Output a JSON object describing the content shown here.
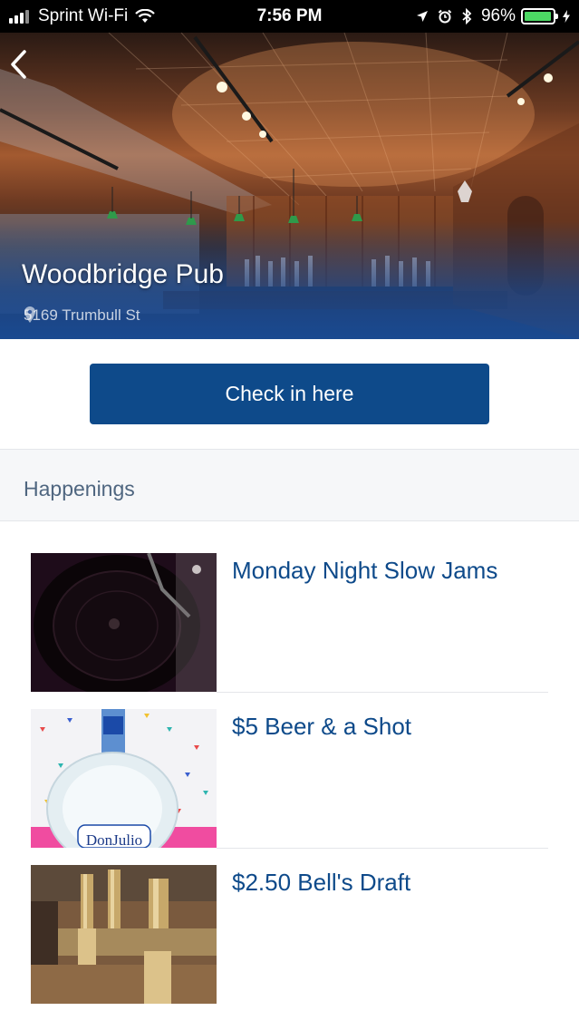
{
  "status_bar": {
    "carrier": "Sprint Wi-Fi",
    "time": "7:56 PM",
    "battery": "96%",
    "battery_level": 0.96
  },
  "venue": {
    "name": "Woodbridge Pub",
    "address": "5169 Trumbull St"
  },
  "checkin": {
    "label": "Check in here"
  },
  "happenings": {
    "title": "Happenings",
    "items": [
      {
        "title": "Monday Night Slow Jams",
        "image": "record-player"
      },
      {
        "title": "$5 Beer & a Shot",
        "image": "tequila-bottle"
      },
      {
        "title": "$2.50 Bell's Draft",
        "image": "beer-taps"
      }
    ]
  },
  "colors": {
    "accent": "#0e4a8a",
    "section_bg": "#f6f7f9",
    "section_text": "#4f6680"
  }
}
